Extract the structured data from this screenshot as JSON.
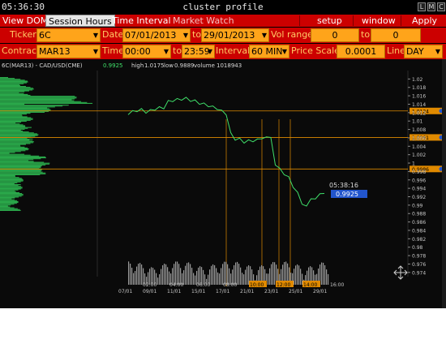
{
  "window": {
    "clock": "05:36:30",
    "title": "cluster profile",
    "buttons": [
      "L",
      "M",
      "C"
    ]
  },
  "menu": {
    "items": [
      "View DOM",
      "Session Hours",
      "Time Interval",
      "Market Watch",
      "setup",
      "window",
      "Apply"
    ]
  },
  "controls": {
    "ticker_label": "Ticker",
    "ticker": "6C",
    "date_label": "Date",
    "date_from": "07/01/2013",
    "date_to_label": "to",
    "date_to": "29/01/2013",
    "vol_label": "Vol range",
    "vol_from": "0",
    "vol_to_label": "to",
    "vol_to": "0",
    "contract_label": "Contract",
    "contract": "MAR13",
    "time_label": "Time",
    "time_from": "00:00",
    "time_to_label": "to",
    "time_to": "23:59",
    "interval_label": "Interval",
    "interval": "60 MIN",
    "price_scale_label": "Price Scale",
    "price_scale": "0.0001",
    "line_label": "Line",
    "line": "DAY"
  },
  "chart_info": {
    "symbol": "6C(MAR13) - CAD/USD(CME)",
    "last": "0.9925",
    "high_label": "high",
    "high": "1.0175",
    "low_label": "low",
    "low": "0.9889",
    "volume_label": "volume",
    "volume": "1018943",
    "cursor_time": "05:38:16",
    "cursor_price": "0.9925",
    "colors": {
      "price_line": "#3fe06a",
      "profile": "#2aa84a",
      "level_line": "#e08a00",
      "marker": "#2255cc"
    }
  },
  "chart_data": {
    "type": "line",
    "y_ticks": [
      "1.02",
      "1.018",
      "1.016",
      "1.014",
      "1.012",
      "1.01",
      "1.008",
      "1.006",
      "1.004",
      "1.002",
      "1",
      "0.998",
      "0.996",
      "0.994",
      "0.992",
      "0.99",
      "0.988",
      "0.986",
      "0.984",
      "0.982",
      "0.98",
      "0.978",
      "0.976",
      "0.974"
    ],
    "level_labels": [
      "1.0124",
      "1.0061",
      "0.9986"
    ],
    "ylim": [
      0.973,
      1.022
    ],
    "time_ticks": [
      "02:00",
      "04:00",
      "06:00",
      "08:00",
      "10:00",
      "12:00",
      "14:00",
      "16:00"
    ],
    "date_ticks": [
      "07/01",
      "09/01",
      "11/01",
      "15/01",
      "17/01",
      "21/01",
      "23/01",
      "25/01",
      "29/01"
    ],
    "price_points": [
      1.0115,
      1.0125,
      1.0122,
      1.013,
      1.0118,
      1.0128,
      1.0125,
      1.0135,
      1.0128,
      1.015,
      1.0145,
      1.0155,
      1.0148,
      1.0158,
      1.0145,
      1.0152,
      1.0138,
      1.0145,
      1.0132,
      1.0138,
      1.0125,
      1.0128,
      1.0112,
      1.0075,
      1.0052,
      1.0062,
      1.0045,
      1.0058,
      1.0048,
      1.006,
      1.0055,
      1.0065,
      1.0058,
      0.9998,
      0.9985,
      0.9975,
      0.9965,
      0.9945,
      0.9928,
      0.9905,
      0.9895,
      0.9918,
      0.9912,
      0.993,
      0.9925
    ]
  }
}
